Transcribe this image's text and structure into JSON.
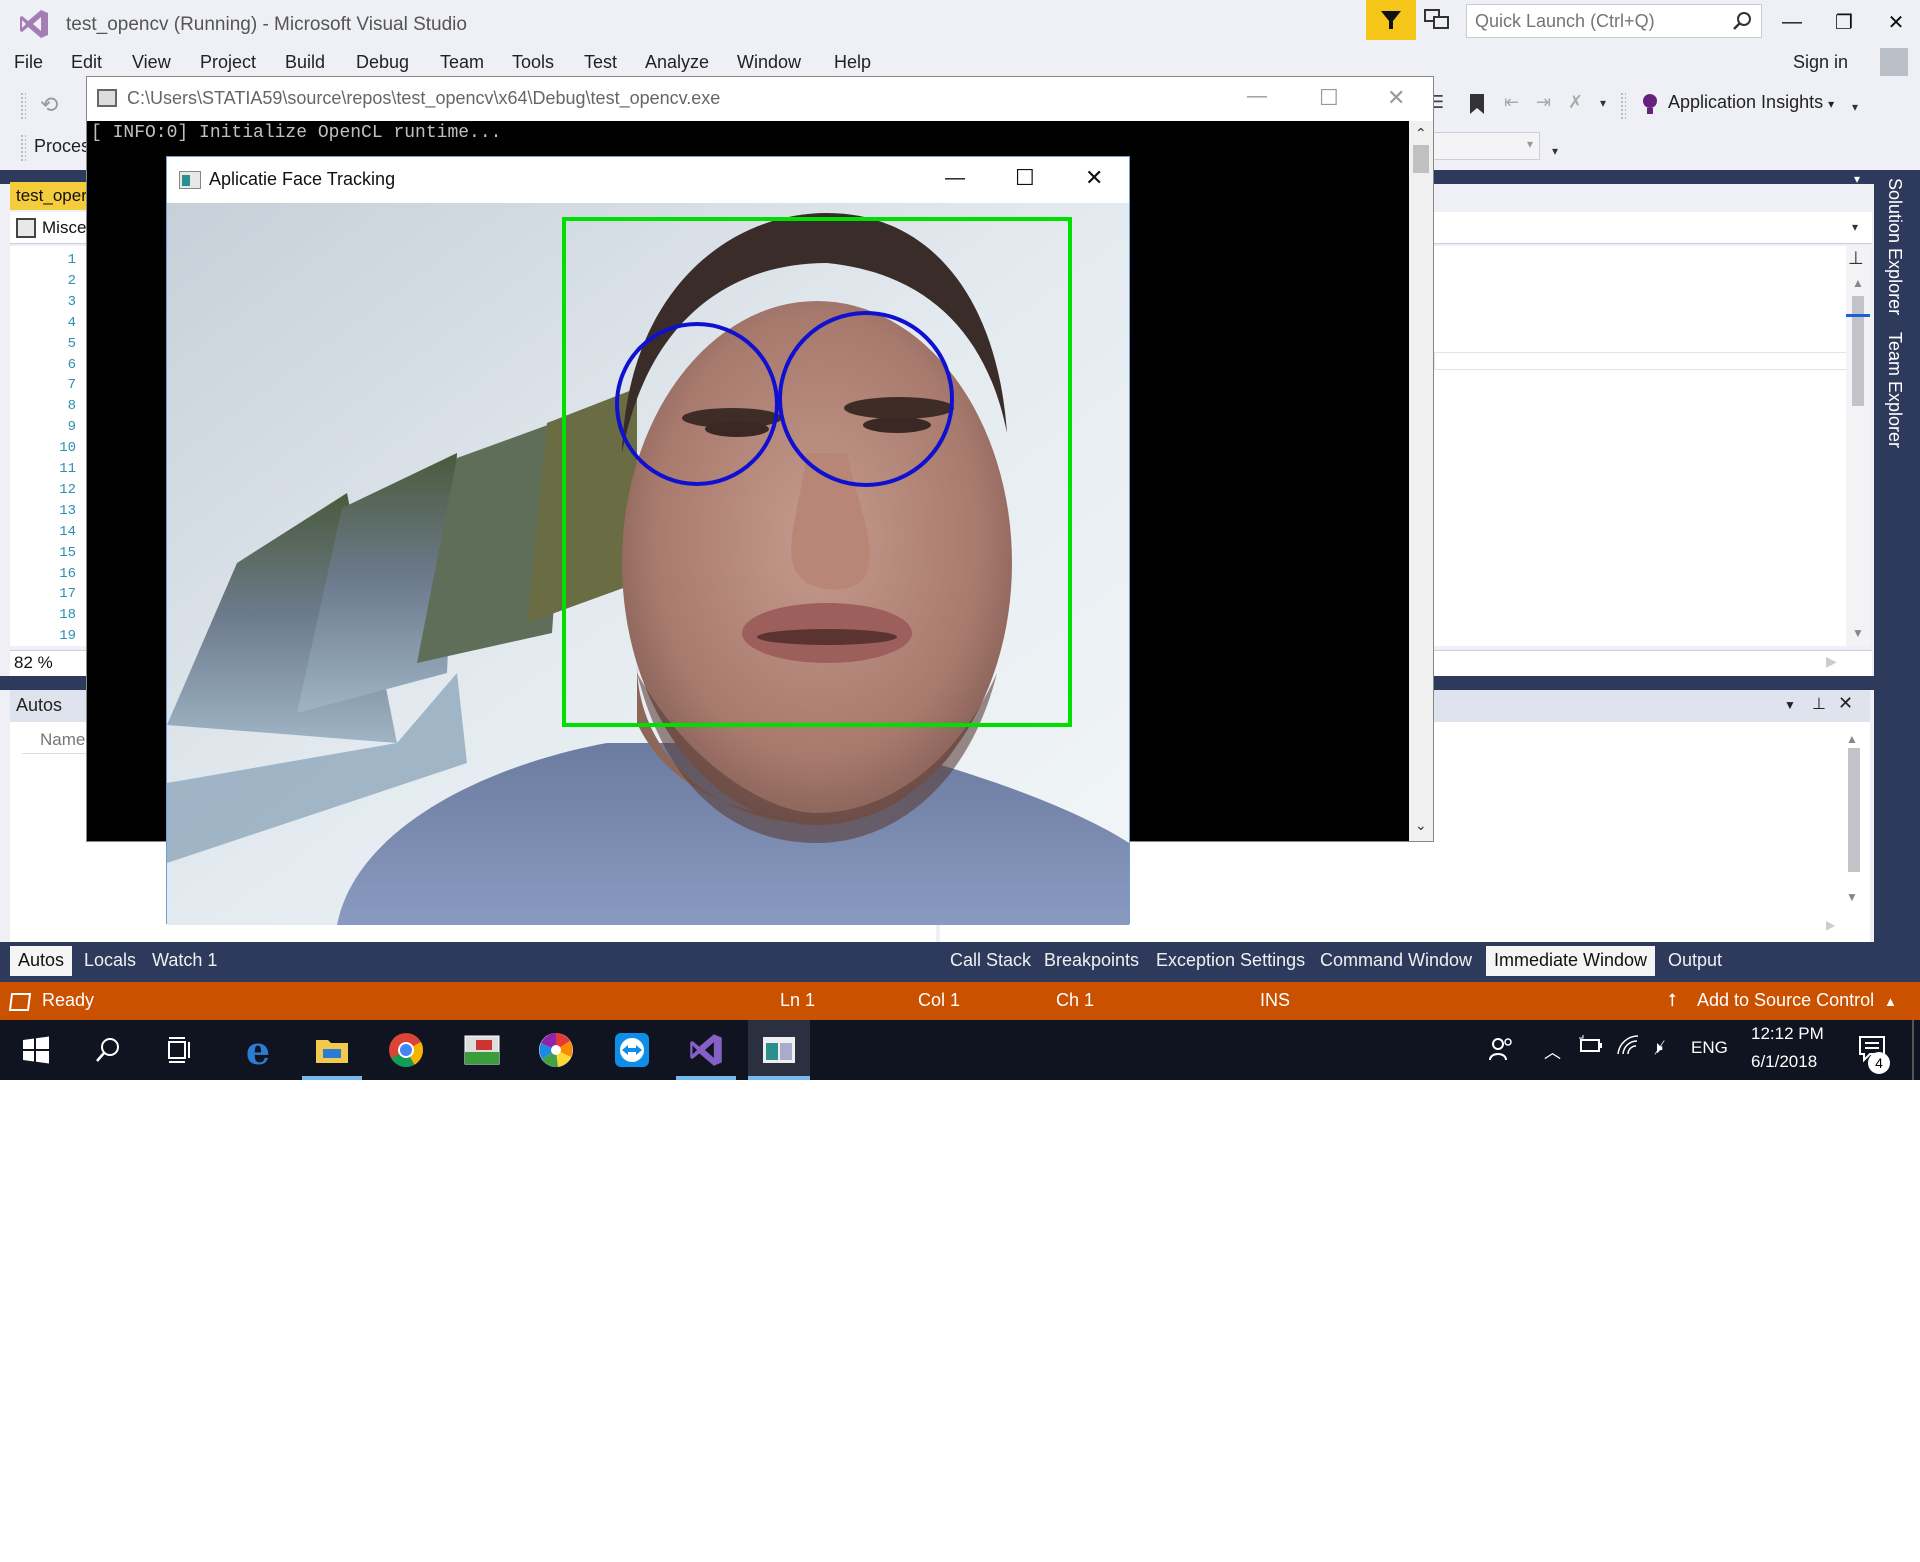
{
  "vs": {
    "window_title": "test_opencv (Running) - Microsoft Visual Studio",
    "quick_launch_placeholder": "Quick Launch (Ctrl+Q)",
    "menu": [
      "File",
      "Edit",
      "View",
      "Project",
      "Build",
      "Debug",
      "Team",
      "Tools",
      "Test",
      "Analyze",
      "Window",
      "Help"
    ],
    "sign_in": "Sign in",
    "app_insights": "Application Insights",
    "process_label": "Proces",
    "doc_tab": "test_oper",
    "nav_label": "Misce",
    "line_numbers": [
      "1",
      "2",
      "3",
      "4",
      "5",
      "6",
      "7",
      "8",
      "9",
      "10",
      "11",
      "12",
      "13",
      "14",
      "15",
      "16",
      "17",
      "18",
      "19"
    ],
    "zoom": "82 %",
    "side_tabs": {
      "solution_explorer": "Solution Explorer",
      "team_explorer": "Team Explorer"
    },
    "autos": {
      "title": "Autos",
      "col_name": "Name"
    },
    "bottom_tabs_left": [
      "Autos",
      "Locals",
      "Watch 1"
    ],
    "bottom_tabs_right": [
      "Call Stack",
      "Breakpoints",
      "Exception Settings",
      "Command Window",
      "Immediate Window",
      "Output"
    ],
    "active_right_tab": "Immediate Window",
    "status": {
      "ready": "Ready",
      "ln": "Ln 1",
      "col": "Col 1",
      "ch": "Ch 1",
      "ins": "INS",
      "source_control": "Add to Source Control"
    },
    "colors": {
      "accent_status": "#ca5100",
      "filter_yellow": "#f5c518",
      "dark_band": "#2d3a5c"
    }
  },
  "console": {
    "title": "C:\\Users\\STATIA59\\source\\repos\\test_opencv\\x64\\Debug\\test_opencv.exe",
    "output": "[ INFO:0] Initialize OpenCL runtime..."
  },
  "face_window": {
    "title": "Aplicatie Face Tracking",
    "face_box_color": "#00e000",
    "eye_circle_color": "#1010d0"
  },
  "taskbar": {
    "apps": [
      "start-icon",
      "search-icon",
      "task-view-icon",
      "edge-icon",
      "file-explorer-icon",
      "chrome-icon",
      "photo-app-icon",
      "picasa-icon",
      "teamviewer-icon",
      "visual-studio-icon",
      "opencv-window-icon"
    ],
    "language": "ENG",
    "time": "12:12 PM",
    "date": "6/1/2018",
    "notifications": "4"
  }
}
